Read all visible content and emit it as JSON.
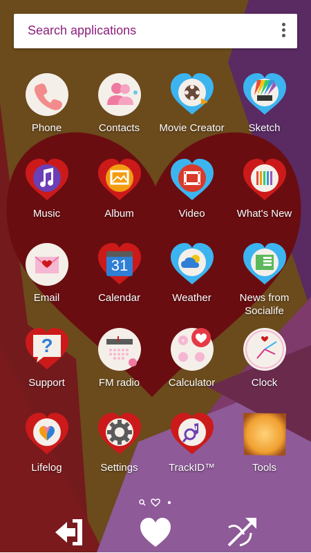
{
  "search": {
    "placeholder": "Search applications"
  },
  "colors": {
    "brown": "#6b4a1c",
    "purple": "#5a2a63",
    "maroon": "#731a1d",
    "heart": "#6a0d10",
    "lavender": "#8e5a98",
    "search_text": "#8b1f7a"
  },
  "apps": [
    {
      "label": "Phone",
      "icon": "phone-icon"
    },
    {
      "label": "Contacts",
      "icon": "contacts-icon"
    },
    {
      "label": "Movie Creator",
      "icon": "movie-creator-icon"
    },
    {
      "label": "Sketch",
      "icon": "sketch-icon"
    },
    {
      "label": "Music",
      "icon": "music-icon"
    },
    {
      "label": "Album",
      "icon": "album-icon"
    },
    {
      "label": "Video",
      "icon": "video-icon"
    },
    {
      "label": "What's New",
      "icon": "whats-new-icon"
    },
    {
      "label": "Email",
      "icon": "email-icon"
    },
    {
      "label": "Calendar",
      "icon": "calendar-icon",
      "date": "31"
    },
    {
      "label": "Weather",
      "icon": "weather-icon"
    },
    {
      "label": "News from Socialife",
      "icon": "news-icon"
    },
    {
      "label": "Support",
      "icon": "support-icon",
      "glyph": "?"
    },
    {
      "label": "FM radio",
      "icon": "fm-radio-icon"
    },
    {
      "label": "Calculator",
      "icon": "calculator-icon"
    },
    {
      "label": "Clock",
      "icon": "clock-icon"
    },
    {
      "label": "Lifelog",
      "icon": "lifelog-icon"
    },
    {
      "label": "Settings",
      "icon": "settings-icon"
    },
    {
      "label": "TrackID™",
      "icon": "trackid-icon"
    },
    {
      "label": "Tools",
      "icon": "tools-icon"
    }
  ],
  "page_indicator": {
    "items": [
      "search-icon",
      "heart-icon",
      "dot-icon"
    ]
  },
  "nav": [
    {
      "icon": "exit-icon"
    },
    {
      "icon": "heart-icon"
    },
    {
      "icon": "arrow-icon"
    }
  ]
}
